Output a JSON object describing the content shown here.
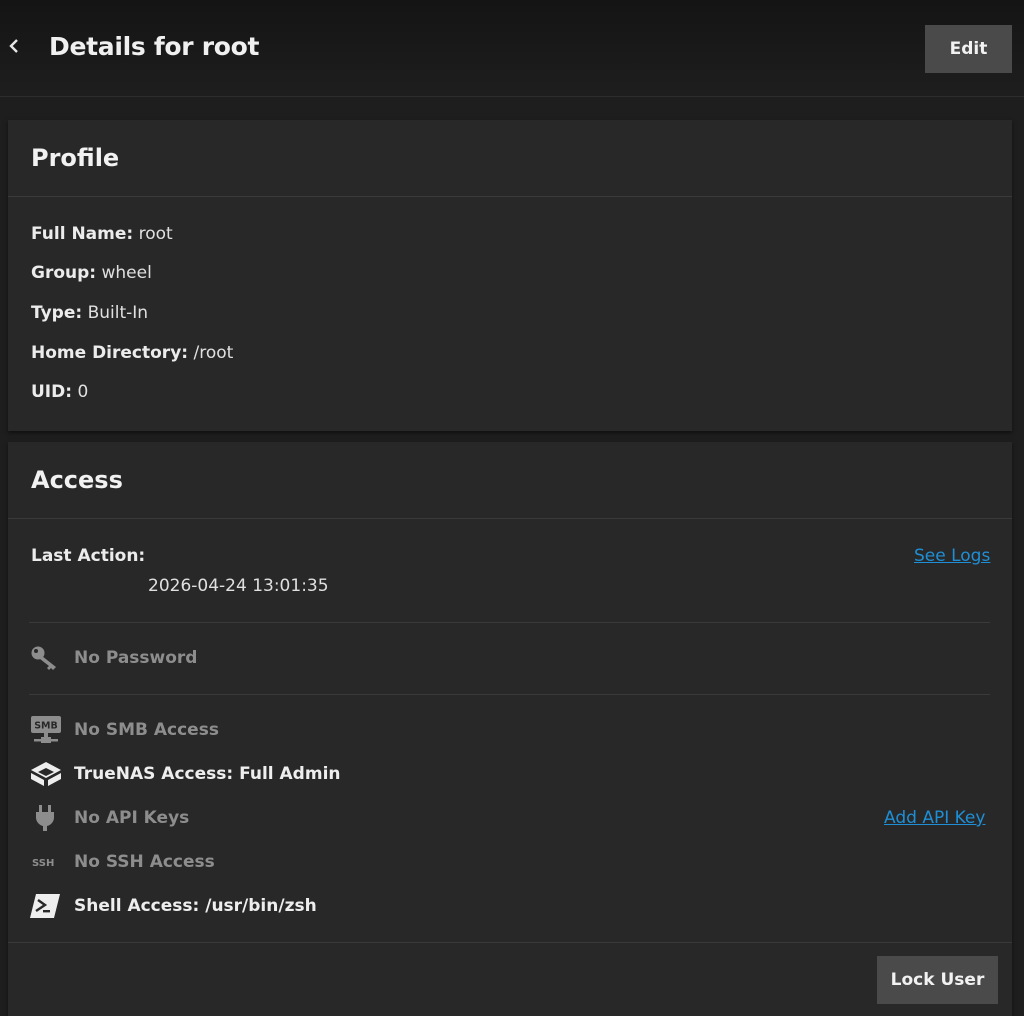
{
  "header": {
    "back_icon": "chevron-left-icon",
    "title": "Details for root",
    "edit_label": "Edit"
  },
  "profile": {
    "title": "Profile",
    "fields": [
      {
        "label": "Full Name:",
        "value": "root"
      },
      {
        "label": "Group:",
        "value": "wheel"
      },
      {
        "label": "Type:",
        "value": "Built-In"
      },
      {
        "label": "Home Directory:",
        "value": " /root"
      },
      {
        "label": "UID:",
        "value": "0"
      }
    ]
  },
  "access": {
    "title": "Access",
    "last_action_label": "Last Action:",
    "last_action_value": "2026-04-24 13:01:35",
    "see_logs_label": "See Logs",
    "password_text": "No Password",
    "smb_text": "No SMB Access",
    "truenas_text": "TrueNAS Access: Full Admin",
    "api_text": "No API Keys",
    "add_api_key_label": "Add API Key",
    "ssh_text": "No SSH Access",
    "shell_text": "Shell Access: /usr/bin/zsh",
    "lock_label": "Lock User",
    "smb_badge": "SMB",
    "ssh_badge": "SSH"
  },
  "colors": {
    "background": "#1e1e1e",
    "card": "#282828",
    "button": "#4a4a4a",
    "link": "#1e8fd6",
    "muted_text": "#8d8d8d"
  }
}
